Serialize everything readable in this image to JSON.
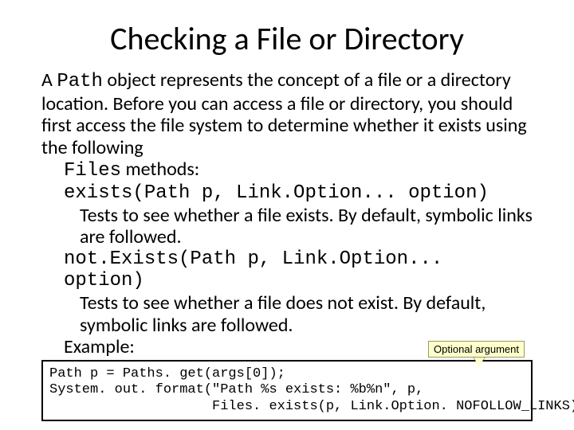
{
  "title": "Checking a File or Directory",
  "intro": {
    "prefix": "A ",
    "path_token": "Path",
    "after_path": " object represents the concept of a file or a directory location. Before you can access a file or directory, you should first access the file system to determine whether it exists using the following ",
    "files_token": "Files",
    "after_files": " methods:"
  },
  "method1": {
    "sig": "exists(Path p, Link.Option... option)",
    "desc": "Tests to see whether a file exists. By default, symbolic links are followed."
  },
  "method2": {
    "sig": "not.Exists(Path p, Link.Option... option)",
    "desc": "Tests to see whether a file does not exist. By default, symbolic links are followed."
  },
  "example_label": "Example:",
  "callout": "Optional argument",
  "code": {
    "l1": "Path p = Paths. get(args[0]);",
    "l2": "System. out. format(\"Path %s exists: %b%n\", p,",
    "l3": "                    Files. exists(p, Link.Option. NOFOLLOW_LINKS));"
  }
}
